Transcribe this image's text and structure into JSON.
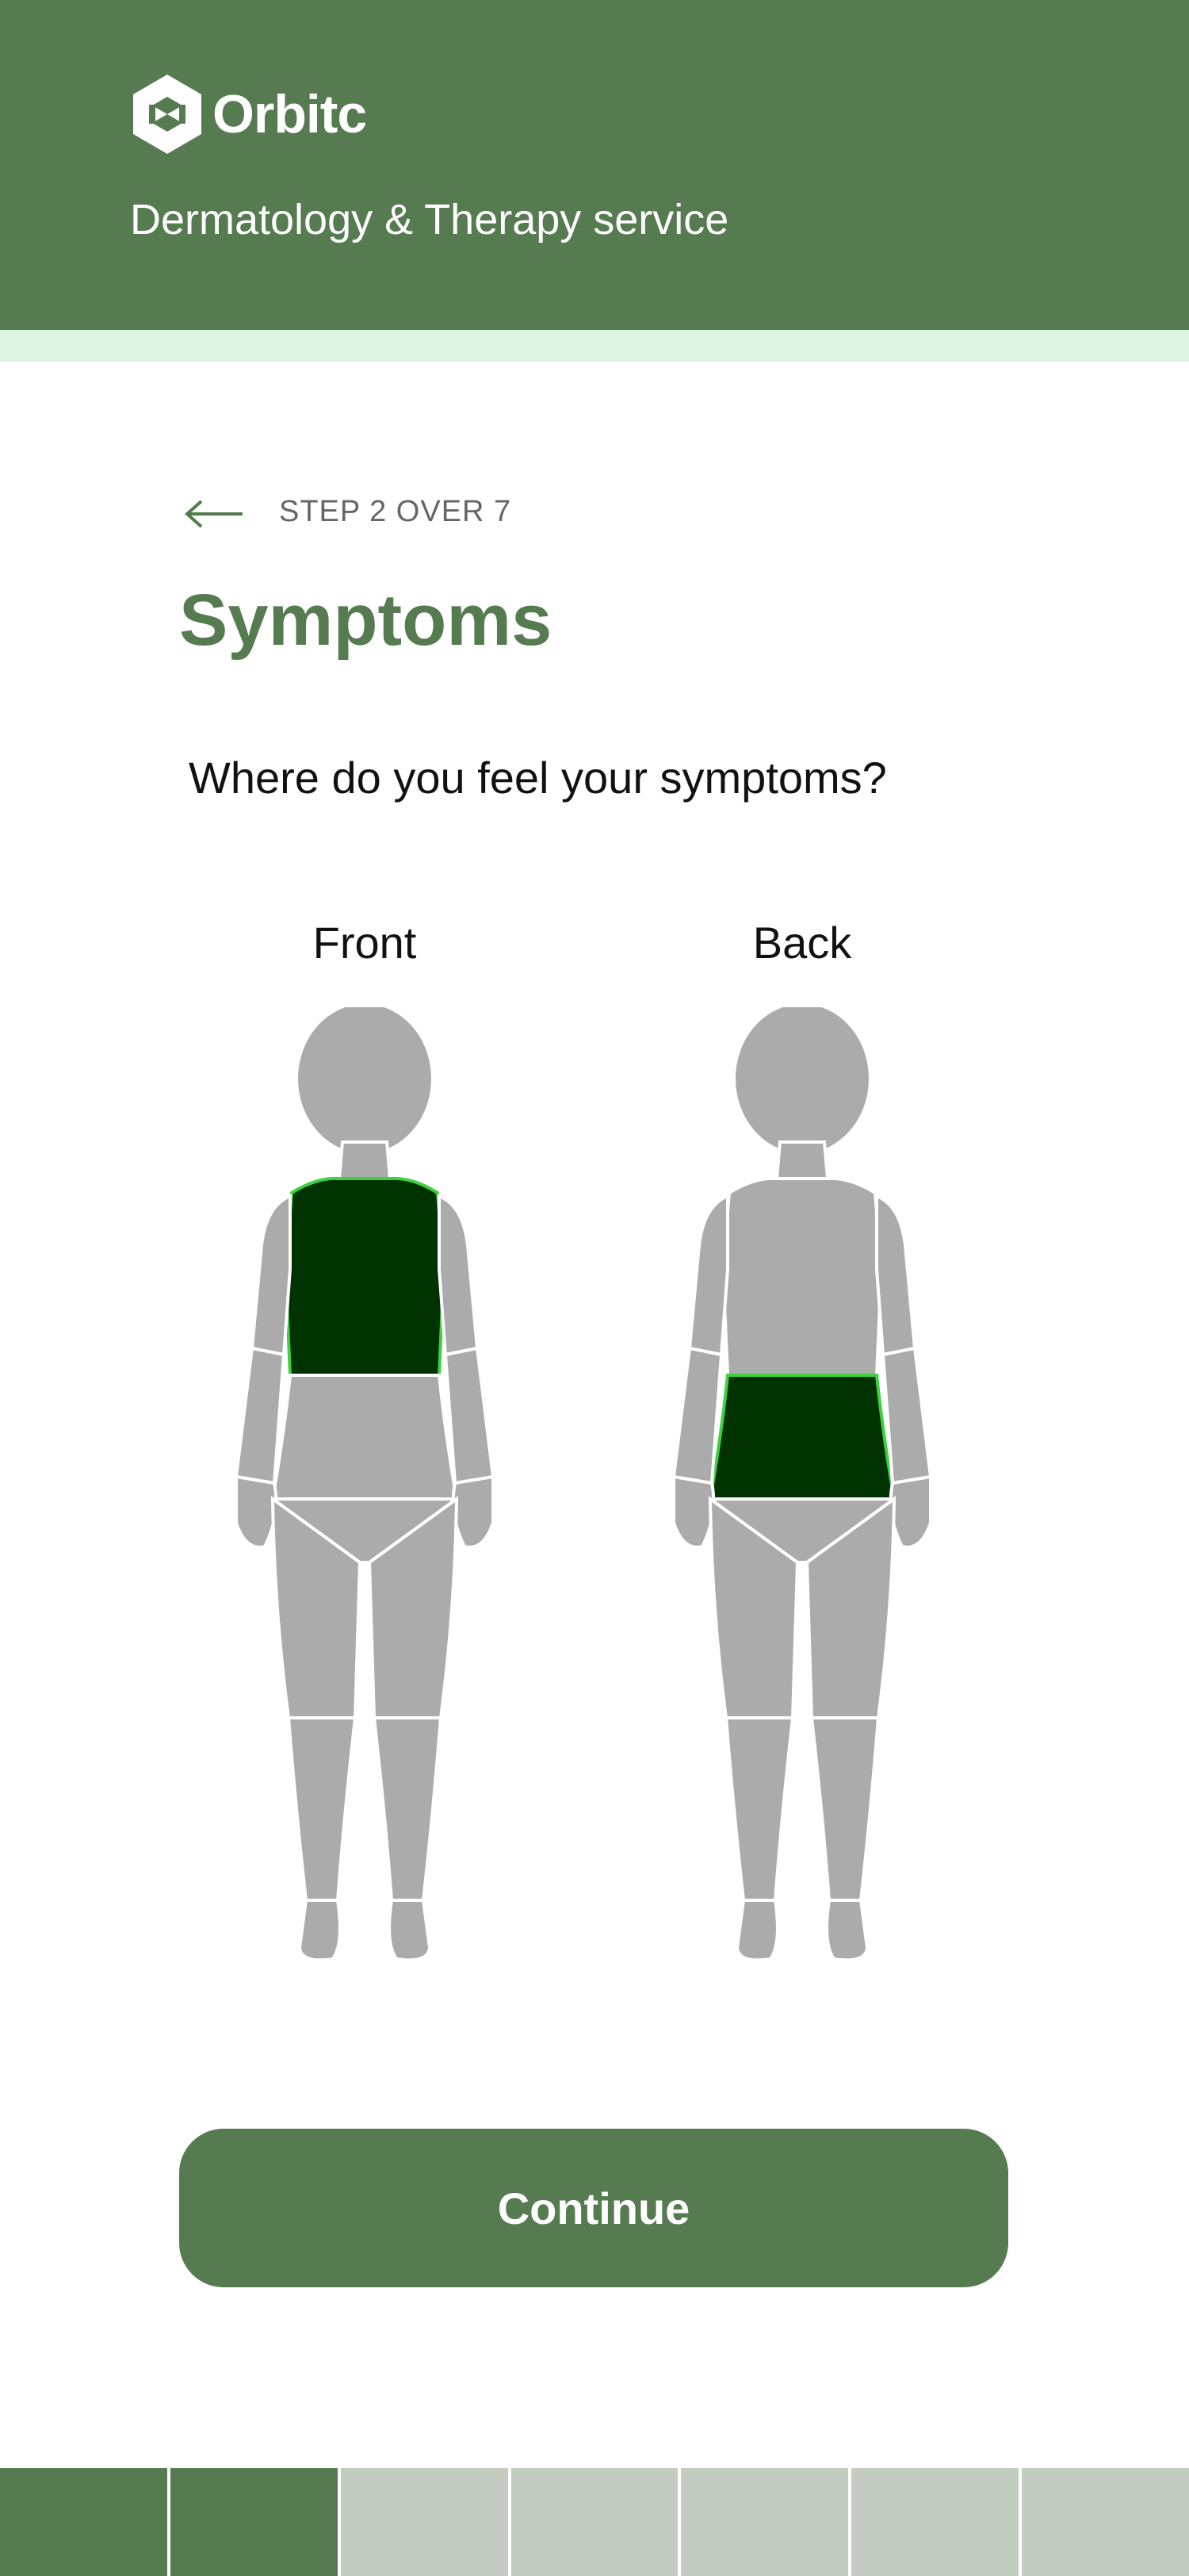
{
  "header": {
    "brand_name": "Orbitc",
    "service_name": "Dermatology & Therapy service",
    "bg_color": "#567b50",
    "strip_color": "#ddf5e0"
  },
  "step": {
    "label": "STEP 2 OVER 7",
    "current": 2,
    "total": 7,
    "back_icon": "arrow-left-icon"
  },
  "page": {
    "title": "Symptoms",
    "question": "Where do you feel your symptoms?"
  },
  "body_map": {
    "front": {
      "label": "Front",
      "selected_regions": [
        "chest"
      ]
    },
    "back": {
      "label": "Back",
      "selected_regions": [
        "lower-back"
      ]
    },
    "selected_color": "#003300",
    "unselected_color": "#ababab"
  },
  "actions": {
    "continue_label": "Continue"
  },
  "colors": {
    "primary": "#567b50",
    "progress_done": "#567b50",
    "progress_todo": "#c3ccc0"
  }
}
